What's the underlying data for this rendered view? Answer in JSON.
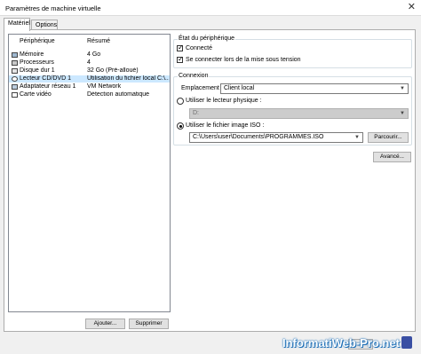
{
  "window": {
    "title": "Paramètres de machine virtuelle"
  },
  "tabs": [
    {
      "label": "Matériel",
      "active": true
    },
    {
      "label": "Options",
      "active": false
    }
  ],
  "device_list": {
    "headers": {
      "device": "Périphérique",
      "summary": "Résumé"
    },
    "rows": [
      {
        "icon": "memory-icon",
        "name": "Mémoire",
        "value": "4 Go",
        "selected": false
      },
      {
        "icon": "cpu-icon",
        "name": "Processeurs",
        "value": "4",
        "selected": false
      },
      {
        "icon": "hard-disk-icon",
        "name": "Disque dur 1",
        "value": "32 Go (Pré-alloué)",
        "selected": false
      },
      {
        "icon": "cd-dvd-icon",
        "name": "Lecteur CD/DVD 1",
        "value": "Utilisation du fichier local C:\\...",
        "selected": true
      },
      {
        "icon": "network-adapter-icon",
        "name": "Adaptateur réseau 1",
        "value": "VM Network",
        "selected": false
      },
      {
        "icon": "video-card-icon",
        "name": "Carte vidéo",
        "value": "Détection automatique",
        "selected": false
      }
    ]
  },
  "list_buttons": {
    "add": "Ajouter...",
    "remove": "Supprimer"
  },
  "device_status": {
    "legend": "État du périphérique",
    "connected": {
      "label": "Connecté",
      "checked": true
    },
    "connect_at_power_on": {
      "label": "Se connecter lors de la mise sous tension",
      "checked": true
    }
  },
  "connection": {
    "legend": "Connexion",
    "location_label": "Emplacement :",
    "location_value": "Client local",
    "physical_drive": {
      "label": "Utiliser le lecteur physique :",
      "selected": false,
      "value": "D:"
    },
    "iso_file": {
      "label": "Utiliser le fichier image ISO :",
      "selected": true,
      "path": "C:\\Users\\user\\Documents\\PROGRAMMES.ISO"
    },
    "browse_label": "Parcourir..."
  },
  "advanced_label": "Avancé...",
  "watermark": {
    "text": "InformatiWeb-Pro.net"
  }
}
